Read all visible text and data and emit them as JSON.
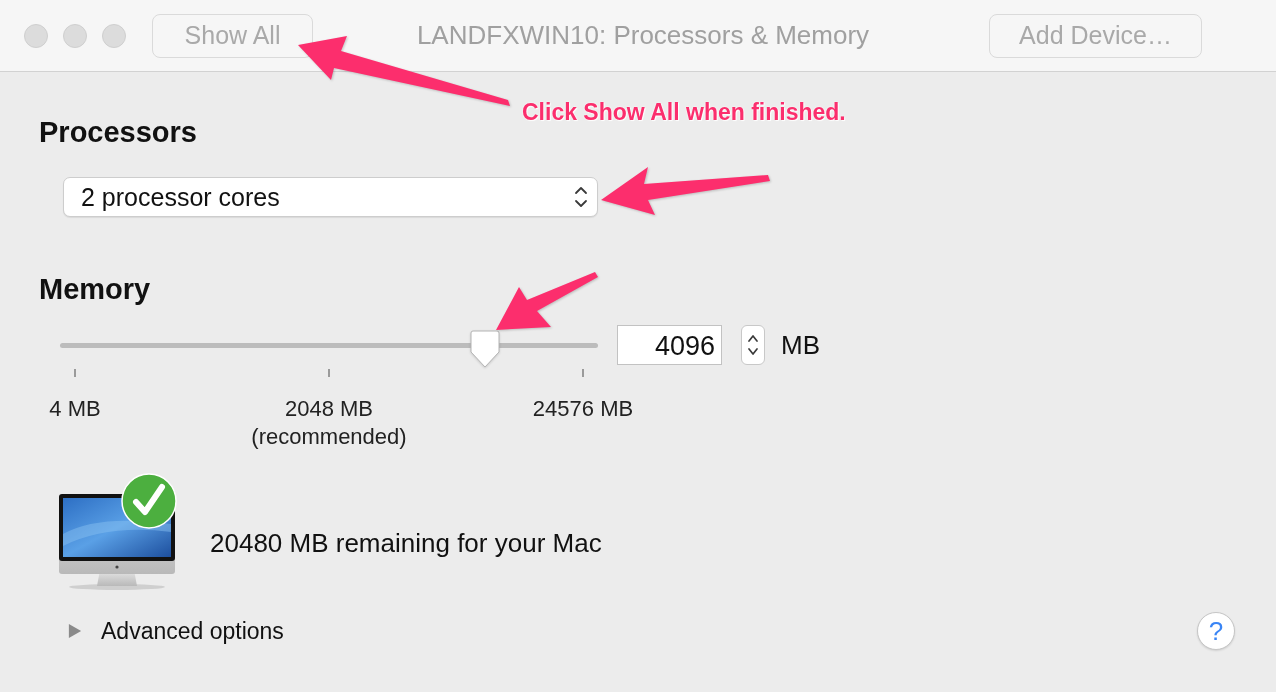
{
  "window": {
    "title": "LANDFXWIN10: Processors & Memory"
  },
  "toolbar": {
    "left_button": "Show All",
    "right_button": "Add Device…"
  },
  "annotation": {
    "callout": "Click Show All when finished."
  },
  "processors": {
    "heading": "Processors",
    "select": {
      "value": "2 processor cores"
    }
  },
  "memory": {
    "heading": "Memory",
    "slider": {
      "level": 0.79,
      "marks": [
        {
          "label": "4 MB"
        },
        {
          "label": "2048 MB",
          "note": "(recommended)"
        },
        {
          "label": "24576 MB"
        }
      ]
    },
    "value": "4096",
    "unit": "MB"
  },
  "status": {
    "ok": true,
    "text": "20480 MB remaining for your Mac"
  },
  "advanced_options": {
    "label": "Advanced options",
    "expanded": false
  },
  "help_button": {
    "label": "?"
  }
}
